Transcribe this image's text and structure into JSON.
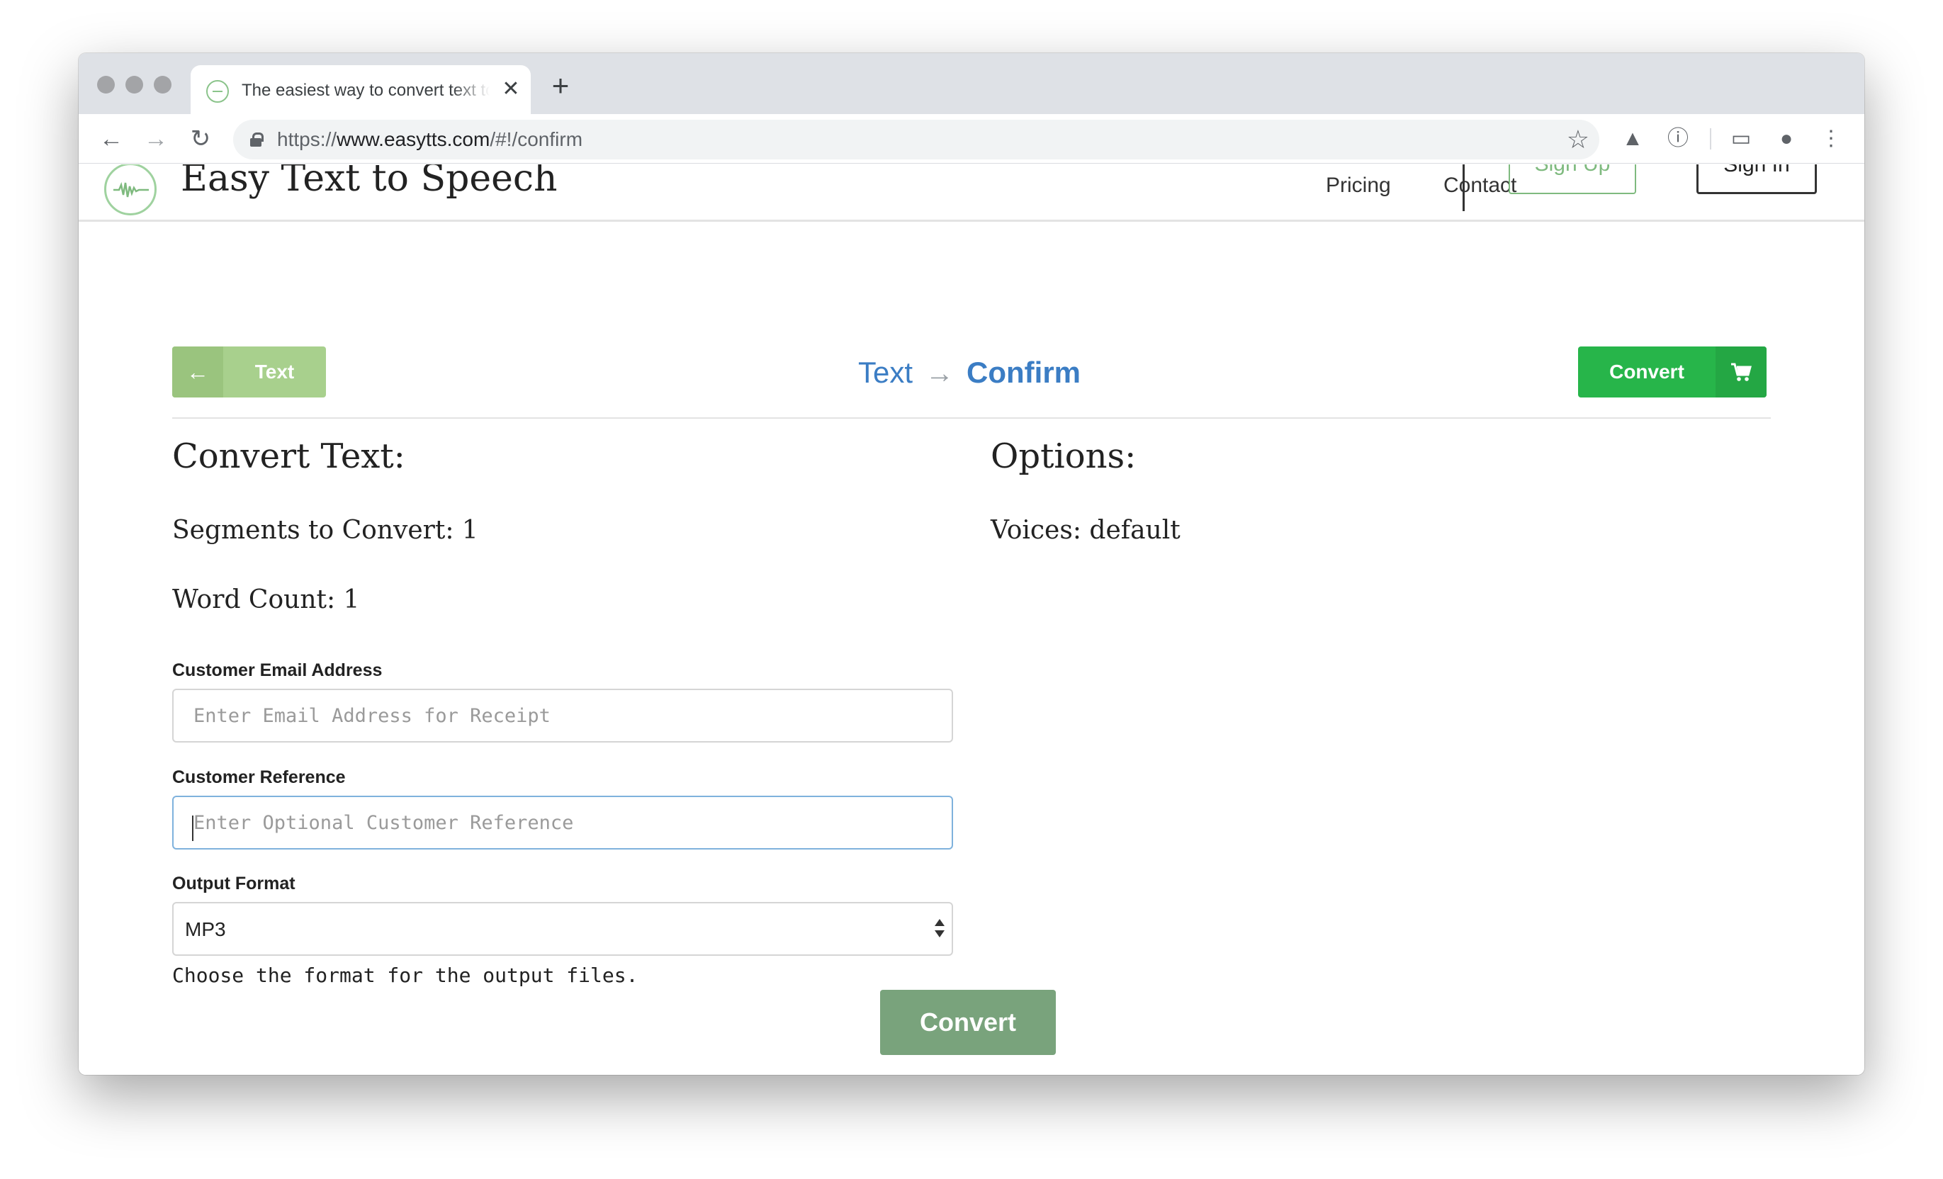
{
  "browser": {
    "tab_title": "The easiest way to convert text to speech",
    "tab_close": "✕",
    "new_tab": "+",
    "url_scheme": "https://",
    "url_host": "www.easytts.com",
    "url_path": "/#!/confirm",
    "nav": {
      "back": "←",
      "forward": "→",
      "reload": "↻"
    },
    "icons": [
      "google-drive-icon",
      "info-icon",
      "cast-icon",
      "profile-icon",
      "more-icon"
    ]
  },
  "site": {
    "title": "Easy Text to Speech",
    "nav": {
      "pricing": "Pricing",
      "contact": "Contact",
      "sign_up": "Sign Up",
      "sign_in": "Sign In"
    }
  },
  "wizard": {
    "back_label": "Text",
    "back_arrow": "←",
    "step_prev": "Text",
    "step_arrow": "→",
    "step_current": "Confirm",
    "convert_label": "Convert"
  },
  "summary": {
    "heading": "Convert Text:",
    "segments": "Segments to Convert: 1",
    "word_count": "Word Count: 1"
  },
  "options": {
    "heading": "Options:",
    "voices": "Voices: default"
  },
  "form": {
    "email_label": "Customer Email Address",
    "email_placeholder": "Enter Email Address for Receipt",
    "email_value": "",
    "reference_label": "Customer Reference",
    "reference_placeholder": "Enter Optional Customer Reference",
    "reference_value": "",
    "format_label": "Output Format",
    "format_value": "MP3",
    "format_help": "Choose the format for the output files.",
    "submit_label": "Convert"
  },
  "colors": {
    "primary_green": "#27b54a",
    "muted_green": "#79a37c",
    "light_green": "#a8d08d",
    "link_blue": "#3b7dc4"
  }
}
